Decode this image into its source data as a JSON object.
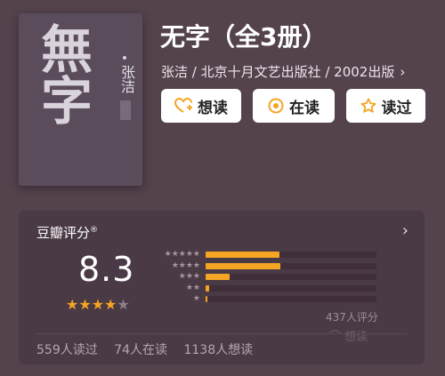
{
  "book": {
    "title": "无字（全3册）",
    "meta": "张洁 / 北京十月文艺出版社 / 2002出版",
    "cover": {
      "title": "無字",
      "author": "张洁"
    }
  },
  "actions": [
    {
      "label": "想读",
      "icon": "heart-plus-icon"
    },
    {
      "label": "在读",
      "icon": "target-icon"
    },
    {
      "label": "读过",
      "icon": "star-outline-icon"
    }
  ],
  "rating": {
    "title": "豆瓣评分",
    "score": "8.3",
    "stars_filled": 4,
    "stars_total": 5,
    "count_label": "437人评分",
    "distribution": [
      {
        "stars": 5,
        "fraction": 0.43
      },
      {
        "stars": 4,
        "fraction": 0.44
      },
      {
        "stars": 3,
        "fraction": 0.14
      },
      {
        "stars": 2,
        "fraction": 0.02
      },
      {
        "stars": 1,
        "fraction": 0.01
      }
    ],
    "stats": {
      "read": "559人读过",
      "reading": "74人在读",
      "want": "1138人想读"
    },
    "faded_action": "想读"
  },
  "colors": {
    "background": "#54424d",
    "card": "#4a3a45",
    "accent": "#f4a523"
  }
}
